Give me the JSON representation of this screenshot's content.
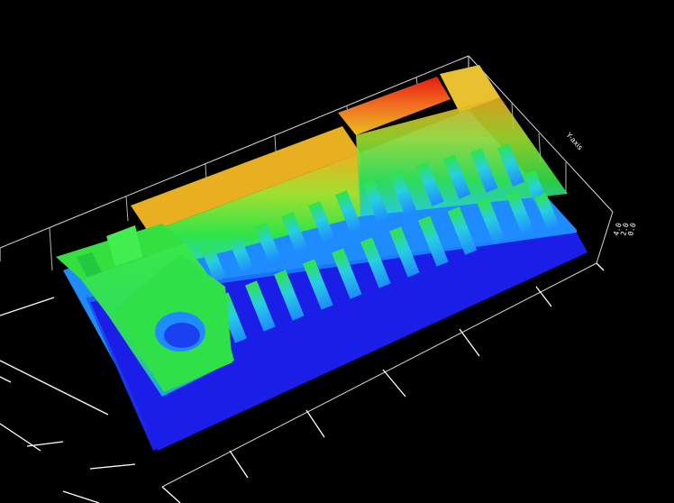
{
  "scene": {
    "background": "#000000",
    "line_color": "#ffffff",
    "description_colors": [
      "#1020e0",
      "#1e90ff",
      "#25d0d0",
      "#33e040",
      "#e6b020",
      "#e02010"
    ]
  },
  "axes": {
    "y_label": "Y-axis",
    "z_tick_labels": [
      "4.0",
      "2.0",
      "0.0"
    ]
  },
  "colormap": {
    "base": "#1a1ee6",
    "low": "#1e8cff",
    "mid_low": "#28cfe0",
    "mid": "#2fe448",
    "high": "#f0b020",
    "peak": "#e61c10"
  }
}
